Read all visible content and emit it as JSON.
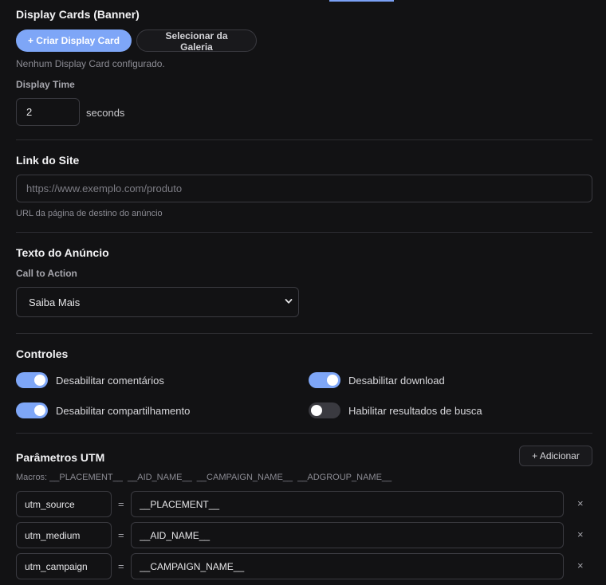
{
  "display_cards": {
    "title": "Display Cards (Banner)",
    "create_button": "+ Criar Display Card",
    "gallery_button": "Selecionar da Galeria",
    "empty_note": "Nenhum Display Card configurado.",
    "display_time_label": "Display Time",
    "display_time_value": "2",
    "display_time_unit": "seconds"
  },
  "site_link": {
    "title": "Link do Site",
    "placeholder": "https://www.exemplo.com/produto",
    "helper": "URL da página de destino do anúncio"
  },
  "ad_text": {
    "title": "Texto do Anúncio",
    "cta_label": "Call to Action",
    "cta_value": "Saiba Mais"
  },
  "controls": {
    "title": "Controles",
    "items": [
      {
        "label": "Desabilitar comentários",
        "on": true
      },
      {
        "label": "Desabilitar download",
        "on": true
      },
      {
        "label": "Desabilitar compartilhamento",
        "on": true
      },
      {
        "label": "Habilitar resultados de busca",
        "on": false
      }
    ]
  },
  "utm": {
    "title": "Parâmetros UTM",
    "add_button": "+ Adicionar",
    "macros_text": "Macros: __PLACEMENT__  __AID_NAME__  __CAMPAIGN_NAME__  __ADGROUP_NAME__",
    "equals": "=",
    "remove_glyph": "×",
    "rows": [
      {
        "key": "utm_source",
        "value": "__PLACEMENT__"
      },
      {
        "key": "utm_medium",
        "value": "__AID_NAME__"
      },
      {
        "key": "utm_campaign",
        "value": "__CAMPAIGN_NAME__"
      }
    ]
  },
  "colors": {
    "accent": "#7ea6f7",
    "background": "#121214",
    "border": "#3a3a40"
  }
}
